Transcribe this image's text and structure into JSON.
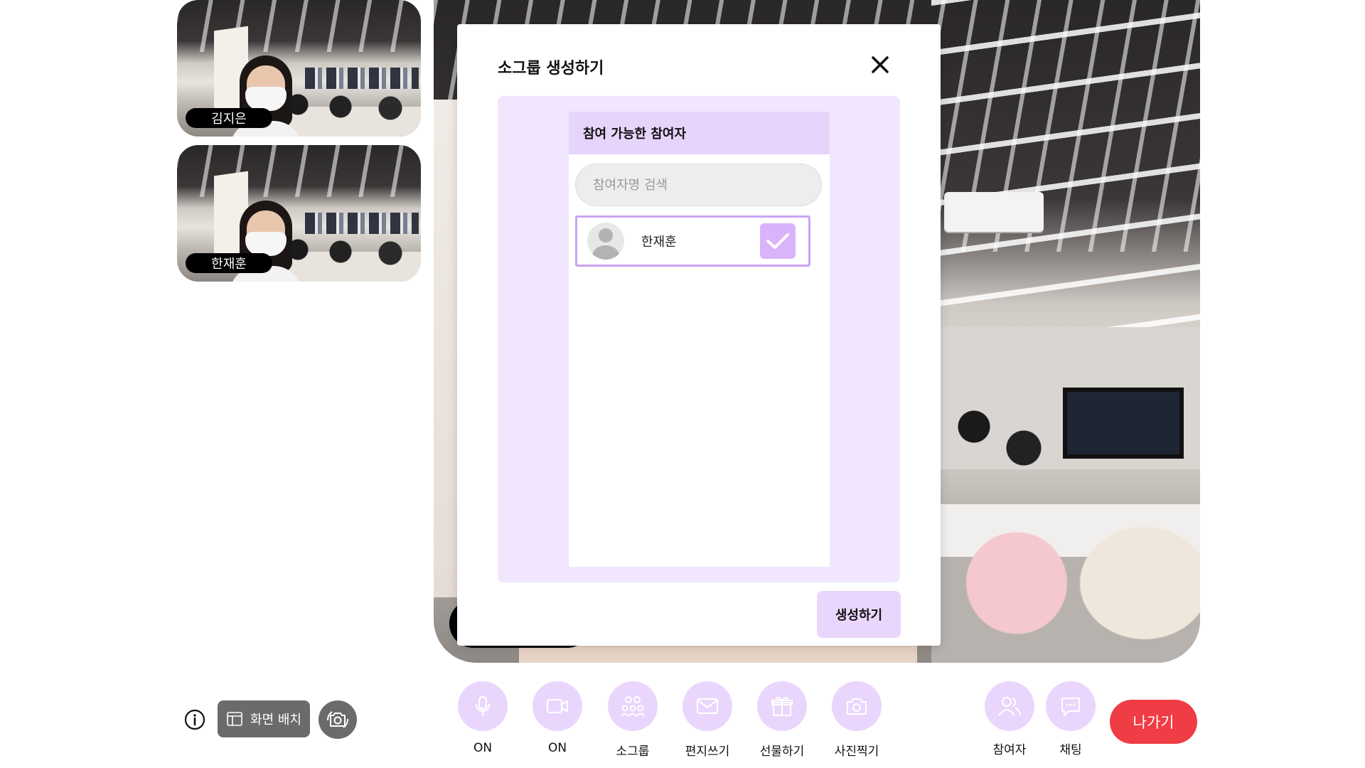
{
  "thumbnails": [
    {
      "name": "김지은"
    },
    {
      "name": "한재훈"
    }
  ],
  "modal": {
    "title": "소그룹 생성하기",
    "list_header": "참여 가능한 참여자",
    "search_placeholder": "참여자명 검색",
    "participants": [
      {
        "name": "한재훈",
        "checked": true
      }
    ],
    "create_label": "생성하기",
    "accent": "#e7d4fb",
    "panel_bg": "#f1e6fd"
  },
  "toolbar": {
    "layout_label": "화면 배치",
    "mic_label": "ON",
    "camera_label": "ON",
    "subgroup_label": "소그룹",
    "letter_label": "편지쓰기",
    "gift_label": "선물하기",
    "photo_label": "사진찍기",
    "participants_label": "참여자",
    "chat_label": "채팅",
    "leave_label": "나가기",
    "tool_bg": "#ead6fc",
    "leave_color": "#f03c44"
  }
}
